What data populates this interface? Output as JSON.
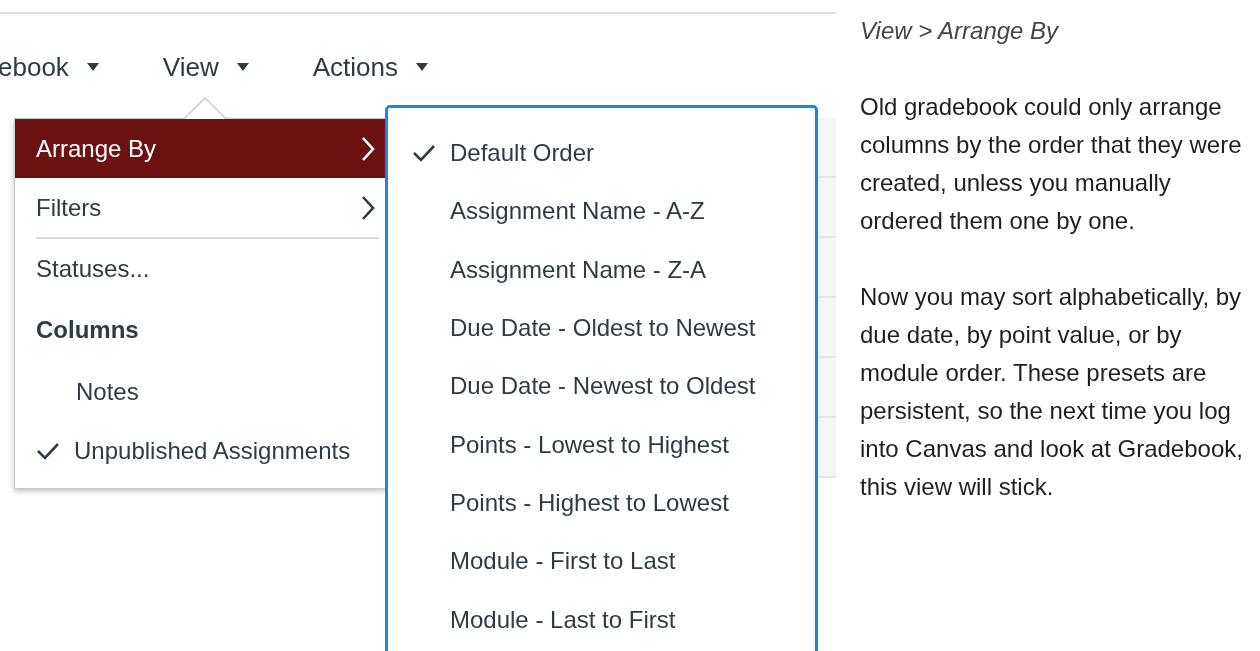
{
  "menu_bar": [
    {
      "label": "ebook"
    },
    {
      "label": "View"
    },
    {
      "label": "Actions"
    }
  ],
  "view_menu": [
    {
      "kind": "submenu",
      "label": "Arrange By",
      "selected": true
    },
    {
      "kind": "submenu",
      "label": "Filters",
      "selected": false
    },
    {
      "kind": "divider"
    },
    {
      "kind": "item",
      "label": "Statuses..."
    },
    {
      "kind": "heading",
      "label": "Columns"
    },
    {
      "kind": "toggle",
      "label": "Notes",
      "checked": false
    },
    {
      "kind": "toggle",
      "label": "Unpublished Assignments",
      "checked": true
    }
  ],
  "arrange_by_menu": [
    {
      "label": "Default Order",
      "selected": true
    },
    {
      "label": "Assignment Name - A-Z",
      "selected": false
    },
    {
      "label": "Assignment Name - Z-A",
      "selected": false
    },
    {
      "label": "Due Date - Oldest to Newest",
      "selected": false
    },
    {
      "label": "Due Date - Newest to Oldest",
      "selected": false
    },
    {
      "label": "Points - Lowest to Highest",
      "selected": false
    },
    {
      "label": "Points - Highest to Lowest",
      "selected": false
    },
    {
      "label": "Module - First to Last",
      "selected": false
    },
    {
      "label": "Module - Last to First",
      "selected": false
    }
  ],
  "notes": {
    "title": "View > Arrange By",
    "paragraphs": [
      "Old gradebook could only arrange columns by the order that they were created, unless you manually ordered them one by one.",
      "Now you may sort alphabetically, by due date, by point value, or by module order. These presets are persistent, so the next time you log into Canvas and look at Gradebook, this view will stick."
    ]
  }
}
